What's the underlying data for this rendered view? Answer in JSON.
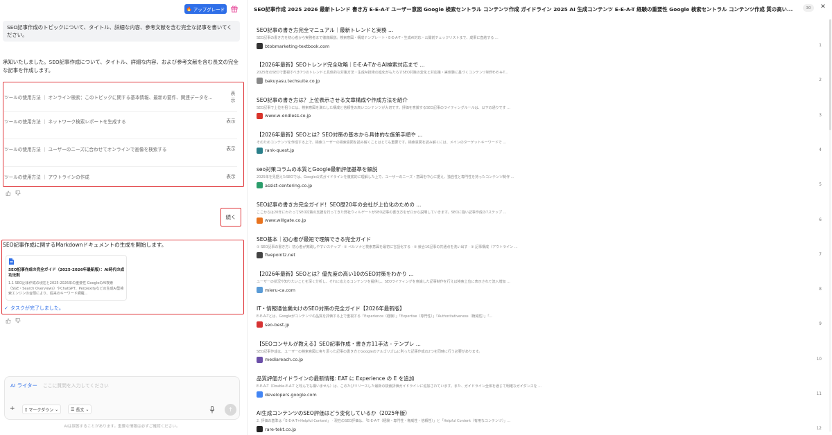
{
  "left": {
    "upgrade_label": "アップグレード",
    "user_message": "SEO記事作成のトピックについて、タイトル、詳細な内容、参考文献を含む完全な記事を書いてください。",
    "ai_intro": "承知いたしました。SEO記事作成について、タイトル、詳細な内容、および参考文献を含む長文の完全な記事を作成します。",
    "tools": [
      {
        "label": "ツールの使用方法 ｜ オンライン検索：このトピックに関する基本情報、最新の要件、関連データを...",
        "action": "表示"
      },
      {
        "label": "ツールの使用方法 ｜ ネットワーク検索レポートを生成する",
        "action": "表示"
      },
      {
        "label": "ツールの使用方法 ｜ ユーザーのニーズに合わせてオンラインで画像を検索する",
        "action": "表示"
      },
      {
        "label": "ツールの使用方法 ｜ アウトラインの作成",
        "action": "表示"
      }
    ],
    "continue_label": "続く",
    "doc_message": "SEO記事作成に関するMarkdownドキュメントの生成を開始します。",
    "doc_card": {
      "title": "SEO記事作成の完全ガイド（2025-2026年最新版）：AI時代の成功法則",
      "body": "1.1 SEO記事作成の現在と2025-2026年の重要性 GoogleのAI検索（SGE・Search Overviews）やChatGPT、Perplexityなどの生成AI型検索エンジンの台頭により、従来のキーワード網羅..."
    },
    "task_done": "タスクが完了しました。",
    "input": {
      "writer_label": "AI ライター",
      "placeholder": "ここに質問を入力してください",
      "format_label": "マークダウン",
      "length_label": "長文"
    },
    "disclaimer": "AIは誤答することがあります。重要な情報は必ずご確認ください。"
  },
  "right": {
    "title": "SEO記事作成 2025 2026 最新トレンド 書き方 E-E-A-T ユーザー意図 Google 検索セントラル コンテンツ作成 ガイドライン 2025 AI 生成コンテンツ E-E-A-T 経験の重要性 Google 検索セントラル コンテンツ作成 質の高い...",
    "count": "30",
    "results": [
      {
        "title": "SEO記事の書き方完全マニュアル｜最新トレンドと実務 ...",
        "snippet": "SEO記事の書き方を初心者から実務者まで徹底解説。検索意図・構成テンプレート・E-E-A-T・生成AI対応・公開前チェックリストまで、成果に直結する ...",
        "source": "btobmarketing-textbook.com",
        "num": "1",
        "fav": "#333333"
      },
      {
        "title": "【2026年最新】SEOトレンド完全攻略｜E-E-A-TからAI検索対応まで ...",
        "snippet": "2025年のSEOで重視すべき7つのトレンドと具体的な対策方法・生成AI技術の進化がもたらすSEO対策の変化と対応策・実体験に基づくコンテンツ制作E-E-A-T...",
        "source": "bakuyasu.techsuite.co.jp",
        "num": "2",
        "fav": "#888888"
      },
      {
        "title": "SEO記事の書き方は？上位表示させる文章構成や作成方法を紹介",
        "snippet": "SEO記事で上位を狙うには、検索意図を満たした構成と信頼性の高いコンテンツが大切です。評価を意識するSEO記事のライティングルールは、以下の通りです ...",
        "source": "www.w-endless.co.jp",
        "num": "3",
        "fav": "#d9342b"
      },
      {
        "title": "【2026年最新】SEOとは？SEO対策の基本から具体的な施策手順や ...",
        "snippet": "そのためコンテンツを作成する上で、検索ユーザーの検索意図を読み解くことはとても重要です。検索意図を読み解くには、メインのターゲットキーワードで ...",
        "source": "rank-quest.jp",
        "num": "4",
        "fav": "#2a7f8a"
      },
      {
        "title": "seo対策コラムの本質とGoogle最新評価基準を解説",
        "snippet": "2025年を見据えたSEOでは、Google公式ガイドラインを徹底的に理解した上で、ユーザーのニーズ・意図を中心に据え、独自性と専門性を持ったコンテンツ制作 ...",
        "source": "assist-centering.co.jp",
        "num": "5",
        "fav": "#2b9d6b"
      },
      {
        "title": "SEO記事の書き方完全ガイド！SEO歴20年の会社が上位化のための ...",
        "snippet": "ここからは20年にわたってSEO対策の支援を行ってきた弊社ウィルゲートがSEO記事の書き方をゼロから説明していきます。SEOに強い記事作成の7ステップ ...",
        "source": "www.willgate.co.jp",
        "num": "6",
        "fav": "#e8731e"
      },
      {
        "title": "SEO基本｜初心者が最短で理解できる完全ガイド",
        "snippet": "① SEO記事の書き方：初心者が実践しやすいステップ · ① ペルソナと検索意図を最初に言語化する · ② 競合10記事の共通点を洗い出す · ③ 記事構成（アウトライン ...",
        "source": "fivepointz.net",
        "num": "7",
        "fav": "#444444"
      },
      {
        "title": "【2026年最新】SEOとは？優先度の高い10のSEO対策をわかり ...",
        "snippet": "ユーザーの状況や知りたいことを深く分析し、それに応えるコンテンツを提供し、SEOライティングを意識した記事制作を行えば検索上位に表示されて流入増加 ...",
        "source": "mieru-ca.com",
        "num": "8",
        "fav": "#5a9bd6"
      },
      {
        "title": "IT・情報通信業向けのSEO対策の完全ガイド【2026年最新版】",
        "snippet": "E-E-A-Tとは、Googleがコンテンツの品質を評価する上で重視する「Experience（経験）」「Expertise（専門性）」「Authoritativeness（権威性）」「...",
        "source": "seo-best.jp",
        "num": "9",
        "fav": "#d63333"
      },
      {
        "title": "【SEOコンサルが教える】SEO記事作成・書き方11手法 - テンプレ ...",
        "snippet": "SEO記事作成は、ユーザーの検索意図に寄り添った記事の書き方とGoogleのアルゴリズムに則った記事作成の2つを同時に行う必要があります。",
        "source": "mediareach.co.jp",
        "num": "10",
        "fav": "#6b4fa8"
      },
      {
        "title": "品質評価ガイドラインの最新情報: EAT に Experience の E を追加",
        "snippet": "E-E-A-T（Double-E-A-T と呼んでも構いません）は、このたびリリースした最新の検索評価ガイドラインに追加されています。また、ガイドライン全体を通じて明確なガイダンスを ...",
        "source": "developers.google.com",
        "num": "11",
        "fav": "#4285f4"
      },
      {
        "title": "AI生成コンテンツのSEO評価はどう変化しているか（2025年版）",
        "snippet": "2. 評価の基準は「E-E-A-T+Helpful Content」 · 現在のSEO評価は、「E-E-A-T（経験・専門性・権威性・信頼性）」と「Helpful Content（有用なコンテンツ）」...",
        "source": "rare-tekt.co.jp",
        "num": "12",
        "fav": "#222222"
      }
    ]
  },
  "colors": {
    "accent": "#2f6fe8",
    "highlight_border": "#e0373b"
  }
}
